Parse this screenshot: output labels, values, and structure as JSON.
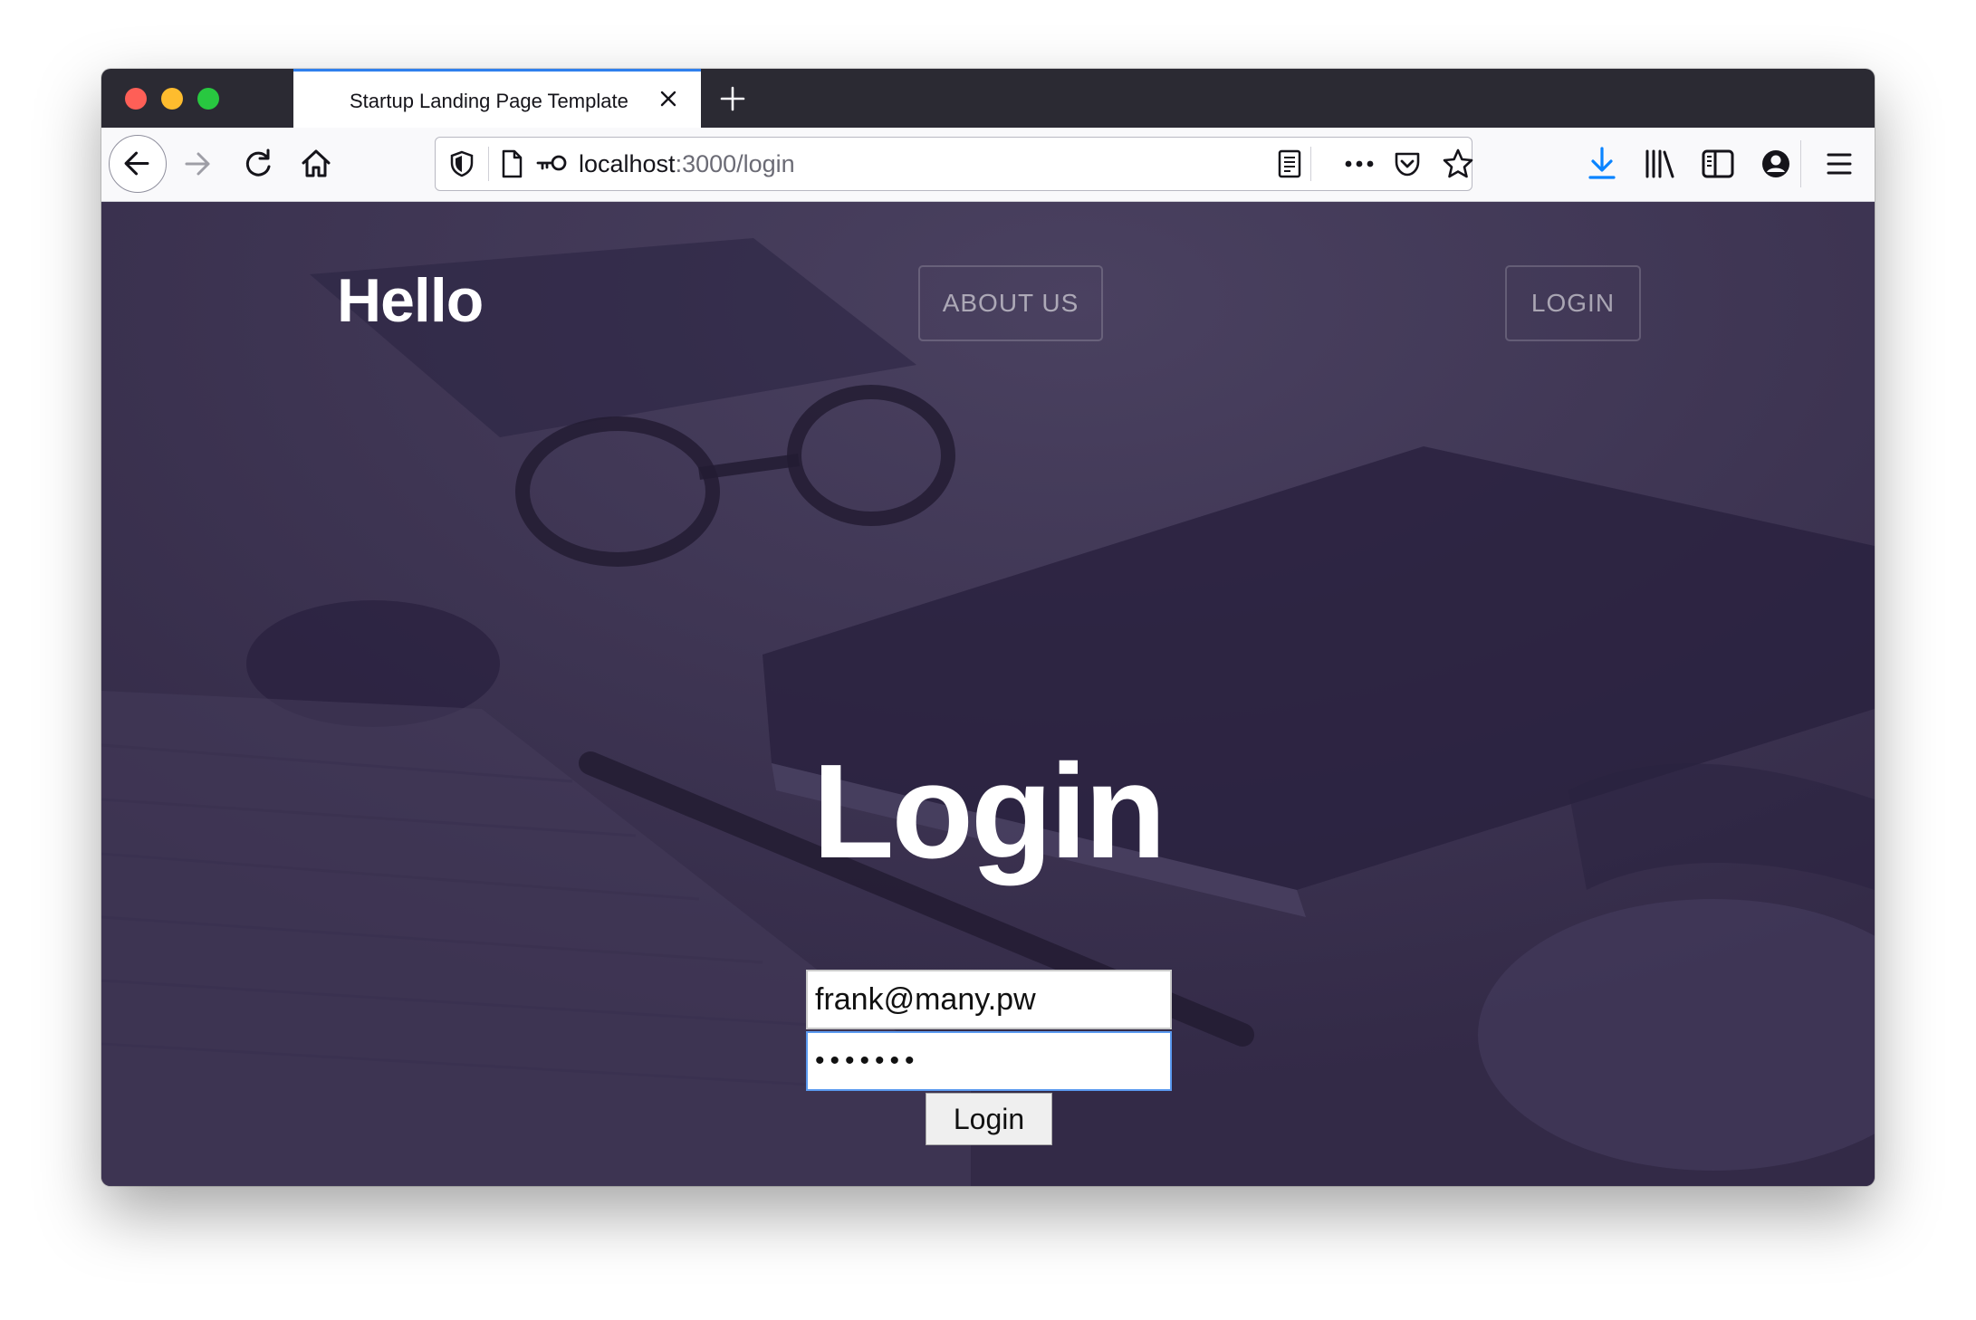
{
  "browser": {
    "tab_title": "Startup Landing Page Template",
    "url_host": "localhost",
    "url_path": ":3000/login",
    "icons": [
      "back-icon",
      "forward-icon",
      "reload-icon",
      "home-icon",
      "shield-icon",
      "page-icon",
      "key-icon",
      "reader-icon",
      "more-icon",
      "pocket-icon",
      "star-icon",
      "download-icon",
      "library-icon",
      "sidebar-icon",
      "account-icon",
      "menu-icon",
      "close-icon",
      "plus-icon"
    ],
    "colors": {
      "tab_accent": "#2f80ed",
      "download_icon": "#0a84ff",
      "tab_strip": "#2b2a33"
    }
  },
  "page": {
    "brand": "Hello",
    "nav": {
      "about": "ABOUT US",
      "login": "LOGIN"
    },
    "heading": "Login",
    "form": {
      "email_value": "frank@many.pw",
      "password_value": "•••••••",
      "submit_label": "Login"
    },
    "colors": {
      "overlay": "#3b3250",
      "focus_border": "#5b9af0"
    }
  }
}
